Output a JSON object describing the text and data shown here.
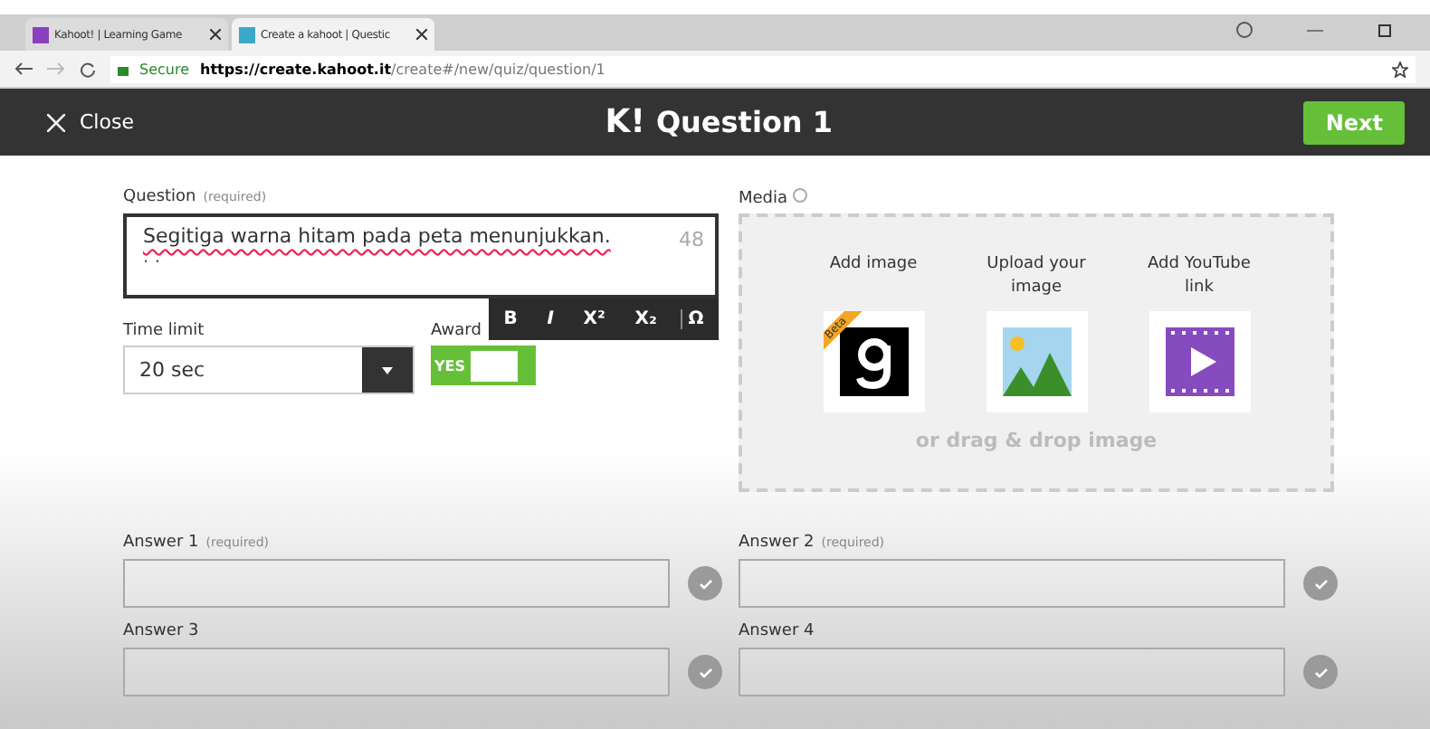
{
  "browser": {
    "tabs": [
      {
        "title": "Kahoot! | Learning Game",
        "selected": false
      },
      {
        "title": "Create a kahoot | Questic",
        "selected": true
      }
    ],
    "address": {
      "secure_label": "Secure",
      "url_host": "https://create.kahoot.it",
      "url_path": "/create#/new/quiz/question/1"
    }
  },
  "header": {
    "close": "Close",
    "logo": "K!",
    "title": "Question 1",
    "next": "Next"
  },
  "question": {
    "label": "Question",
    "hint": "(required)",
    "value": "Segitiga warna hitam pada peta menunjukkan.",
    "value_line2": ". .",
    "count": "48",
    "format_toolbar": [
      {
        "label": "B",
        "kind": "bold"
      },
      {
        "label": "I",
        "kind": "italic"
      },
      {
        "label": "X²",
        "kind": "super"
      },
      {
        "label": "X₂",
        "kind": "sub"
      },
      {
        "label": "Ω",
        "kind": "symbol"
      }
    ]
  },
  "time_limit": {
    "label": "Time limit",
    "value": "20 sec"
  },
  "award": {
    "label": "Award",
    "toggle": "YES",
    "on": true
  },
  "media": {
    "label": "Media",
    "options": [
      {
        "label": "Add image",
        "kind": "getty",
        "badge": "Beta"
      },
      {
        "label": "Upload your image",
        "kind": "upload"
      },
      {
        "label": "Add YouTube link",
        "kind": "youtube"
      }
    ],
    "drop": "or drag & drop image"
  },
  "answers": [
    {
      "label": "Answer 1",
      "hint": "(required)",
      "correct": false
    },
    {
      "label": "Answer 2",
      "hint": "(required)",
      "correct": false
    },
    {
      "label": "Answer 3",
      "correct": false
    },
    {
      "label": "Answer 4",
      "correct": false
    }
  ]
}
